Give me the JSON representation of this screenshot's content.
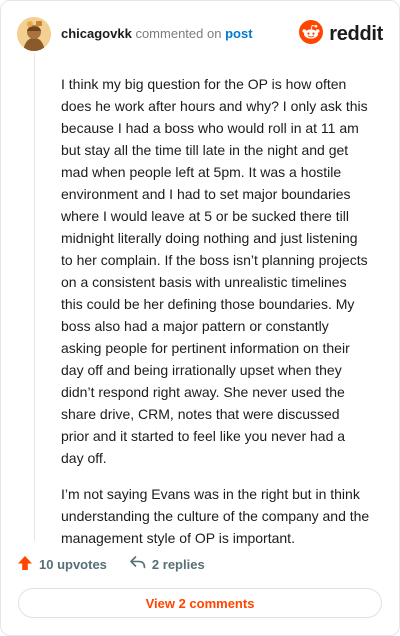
{
  "comment": {
    "username": "chicagovkk",
    "action": "commented on",
    "post_link": "post",
    "paragraphs": [
      "I think my big question for the OP is how often does he work after hours and why? I only ask this because I had a boss who would roll in at 11 am but stay all the time till late in the night and get mad when people left at 5pm. It was a hostile environment and I had to set major boundaries where I would leave at 5 or be sucked there till midnight literally doing nothing and just listening to her complain. If the boss isn’t planning projects on a consistent basis with unrealistic timelines this could be her defining those boundaries. My boss also had a major pattern or constantly asking people for pertinent information on their day off and being irrationally upset when they didn’t respond right away. She never used the share drive, CRM, notes that were discussed prior and it started to feel like you never had a day off.",
      "I’m not saying Evans was in the right but in think understanding the culture of the company and the management style of OP is important."
    ],
    "upvotes_label": "10 upvotes",
    "replies_label": "2 replies"
  },
  "brand": {
    "wordmark": "reddit",
    "accent_color": "#ff4500"
  },
  "view_comments_label": "View 2 comments",
  "icons": {
    "avatar": "user-avatar",
    "logo": "reddit-logo-icon",
    "upvote": "upvote-arrow-icon",
    "reply": "reply-arrow-icon"
  }
}
